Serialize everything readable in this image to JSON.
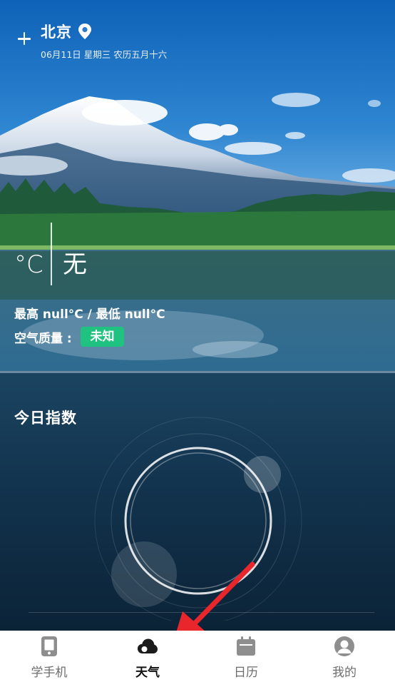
{
  "header": {
    "city": "北京",
    "date_line": "06月11日 星期三  农历五月十六"
  },
  "current": {
    "temp_unit": "°C",
    "condition": "无",
    "hi_lo": "最高 null°C / 最低 null°C",
    "air_quality_label": "空气质量 :",
    "air_quality_value": "未知",
    "air_quality_color": "#1fc27f"
  },
  "index_section": {
    "title": "今日指数"
  },
  "tabbar": {
    "active_index": 1,
    "items": [
      {
        "label": "学手机",
        "icon": "phone-icon"
      },
      {
        "label": "天气",
        "icon": "cloud-icon"
      },
      {
        "label": "日历",
        "icon": "calendar-icon"
      },
      {
        "label": "我的",
        "icon": "profile-icon"
      }
    ]
  },
  "annotation": {
    "arrow_color": "#e8262b",
    "arrow_target": "tab-weather"
  }
}
